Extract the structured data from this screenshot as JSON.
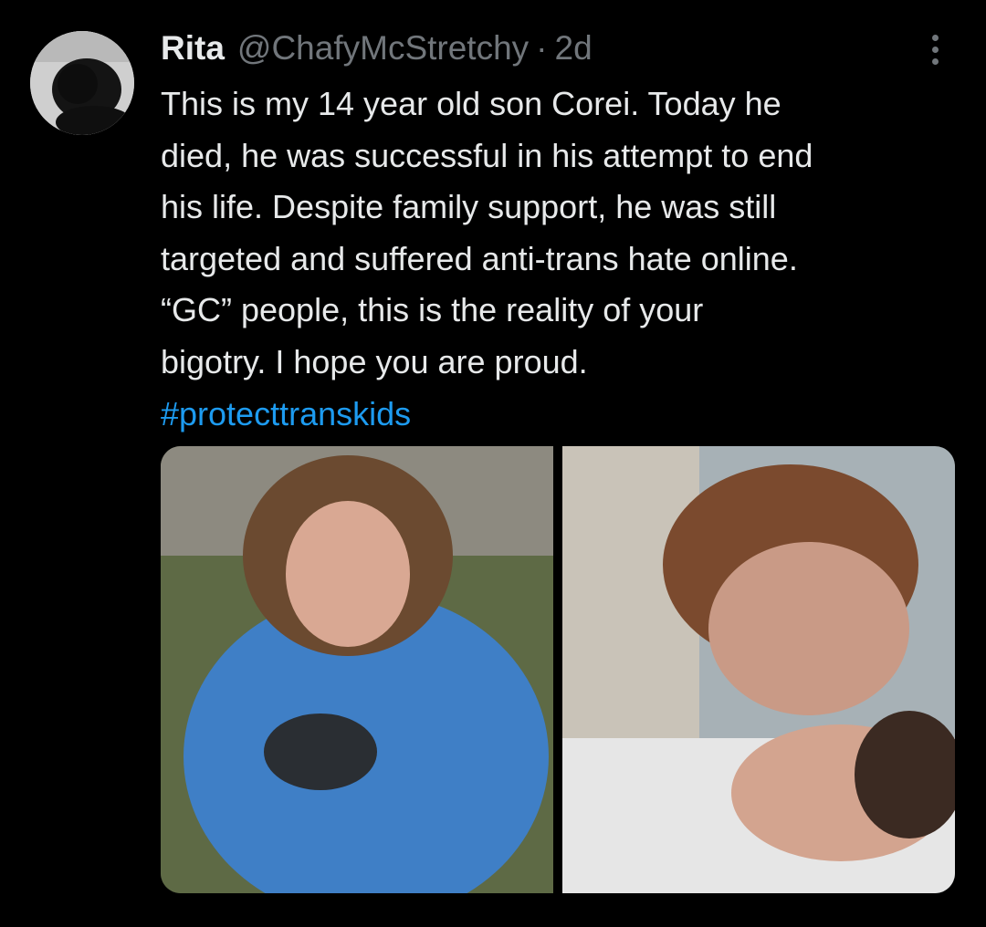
{
  "tweet": {
    "author_name": "Rita",
    "author_handle": "@ChafyMcStretchy",
    "separator": "·",
    "timestamp": "2d",
    "text_lines": [
      "This is my 14 year old son Corei. Today he",
      "died, he was successful in his attempt to end",
      "his life. Despite family support, he was still",
      "targeted and suffered anti-trans hate online.",
      "“GC” people, this is the reality of your",
      "bigotry. I hope you are proud."
    ],
    "hashtag": "#protecttranskids",
    "photos": [
      {
        "name": "photo-left"
      },
      {
        "name": "photo-right"
      }
    ]
  },
  "icons": {
    "more": "more-options-icon"
  },
  "colors": {
    "background": "#000000",
    "text_primary": "#e7e9ea",
    "text_secondary": "#71767b",
    "link": "#1d9bf0"
  }
}
